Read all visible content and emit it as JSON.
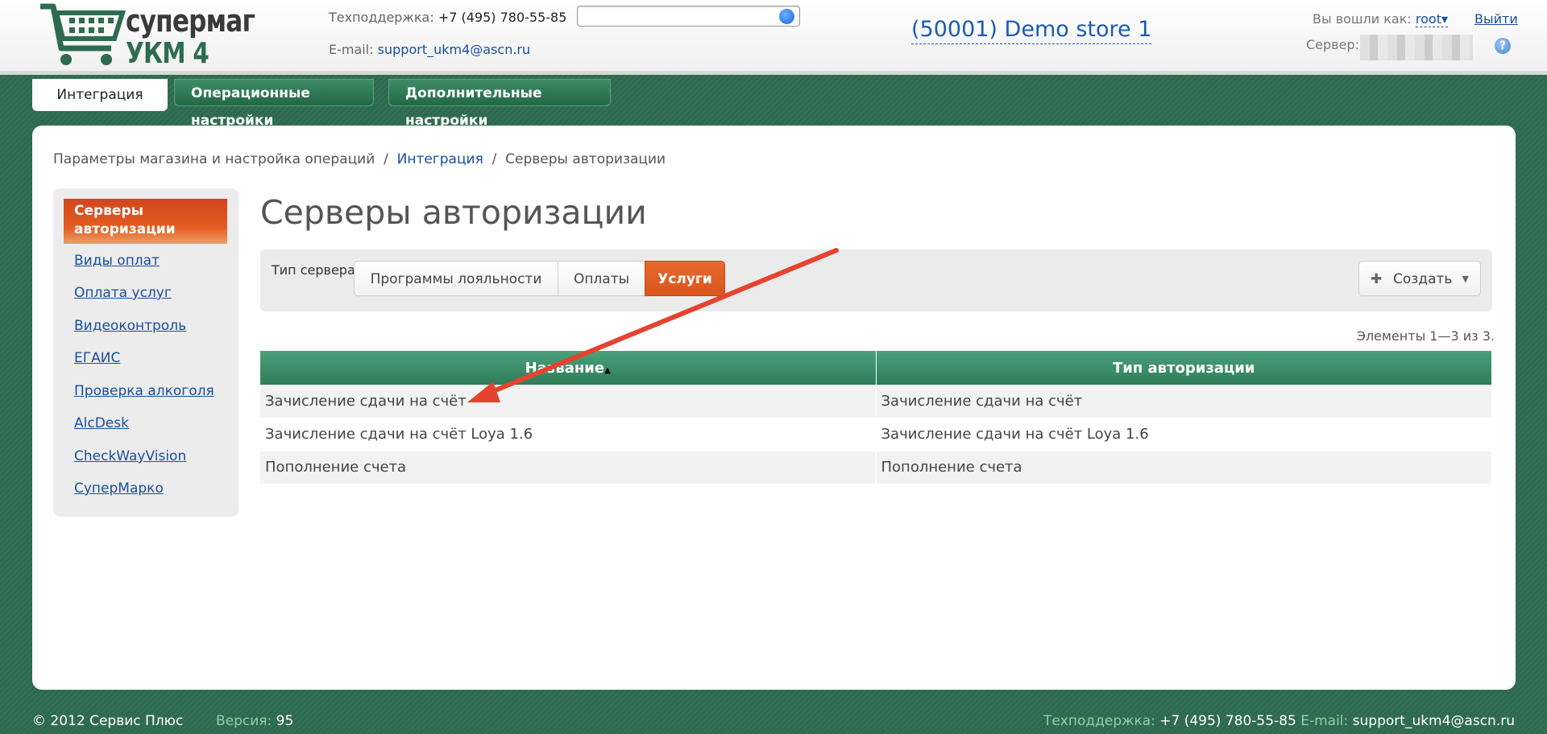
{
  "header": {
    "logo_line1": "супермаг",
    "logo_line2": "УКМ 4",
    "support_label": "Техподдержка:",
    "support_phone": "+7 (495) 780-55-85",
    "email_label": "E-mail:",
    "email": "support_ukm4@ascn.ru",
    "store": "(50001) Demo store 1",
    "logged_label": "Вы вошли как:",
    "user": "root",
    "logout": "Выйти",
    "server_label": "Сервер:",
    "help": "?"
  },
  "tabs": [
    {
      "label": "Интеграция"
    },
    {
      "label": "Операционные настройки"
    },
    {
      "label": "Дополнительные настройки"
    }
  ],
  "breadcrumb": {
    "part1": "Параметры магазина и настройка операций",
    "sep": "/",
    "part2": "Интеграция",
    "part3": "Серверы авторизации"
  },
  "sidebar": {
    "active": "Серверы авторизации",
    "items": [
      {
        "label": "Виды оплат"
      },
      {
        "label": "Оплата услуг"
      },
      {
        "label": "Видеоконтроль"
      },
      {
        "label": "ЕГАИС"
      },
      {
        "label": "Проверка алкоголя"
      },
      {
        "label": "AlcDesk"
      },
      {
        "label": "CheckWayVision"
      },
      {
        "label": "СуперМарко"
      }
    ]
  },
  "main": {
    "title": "Серверы авторизации",
    "server_type_label": "Тип сервера:",
    "segments": [
      {
        "label": "Программы лояльности"
      },
      {
        "label": "Оплаты"
      },
      {
        "label": "Услуги"
      }
    ],
    "create_label": "Создать",
    "count": "Элементы 1—3 из 3.",
    "columns": [
      "Название",
      "Тип авторизации"
    ],
    "rows": [
      [
        "Зачисление сдачи на счёт",
        "Зачисление сдачи на счёт"
      ],
      [
        "Зачисление сдачи на счёт Loya 1.6",
        "Зачисление сдачи на счёт Loya 1.6"
      ],
      [
        "Пополнение счета",
        "Пополнение счета"
      ]
    ]
  },
  "footer": {
    "copyright": "© 2012 Сервис Плюс",
    "version_label": "Версия:",
    "version": "95",
    "support_label": "Техподдержка:",
    "support_phone": "+7 (495) 780-55-85",
    "email_label": "E-mail:",
    "email": "support_ukm4@ascn.ru"
  },
  "colors": {
    "brand_green": "#2e6b50",
    "accent_orange": "#e45d22",
    "link_blue": "#1a4fa0",
    "annotation_arrow": "#e5432f"
  }
}
